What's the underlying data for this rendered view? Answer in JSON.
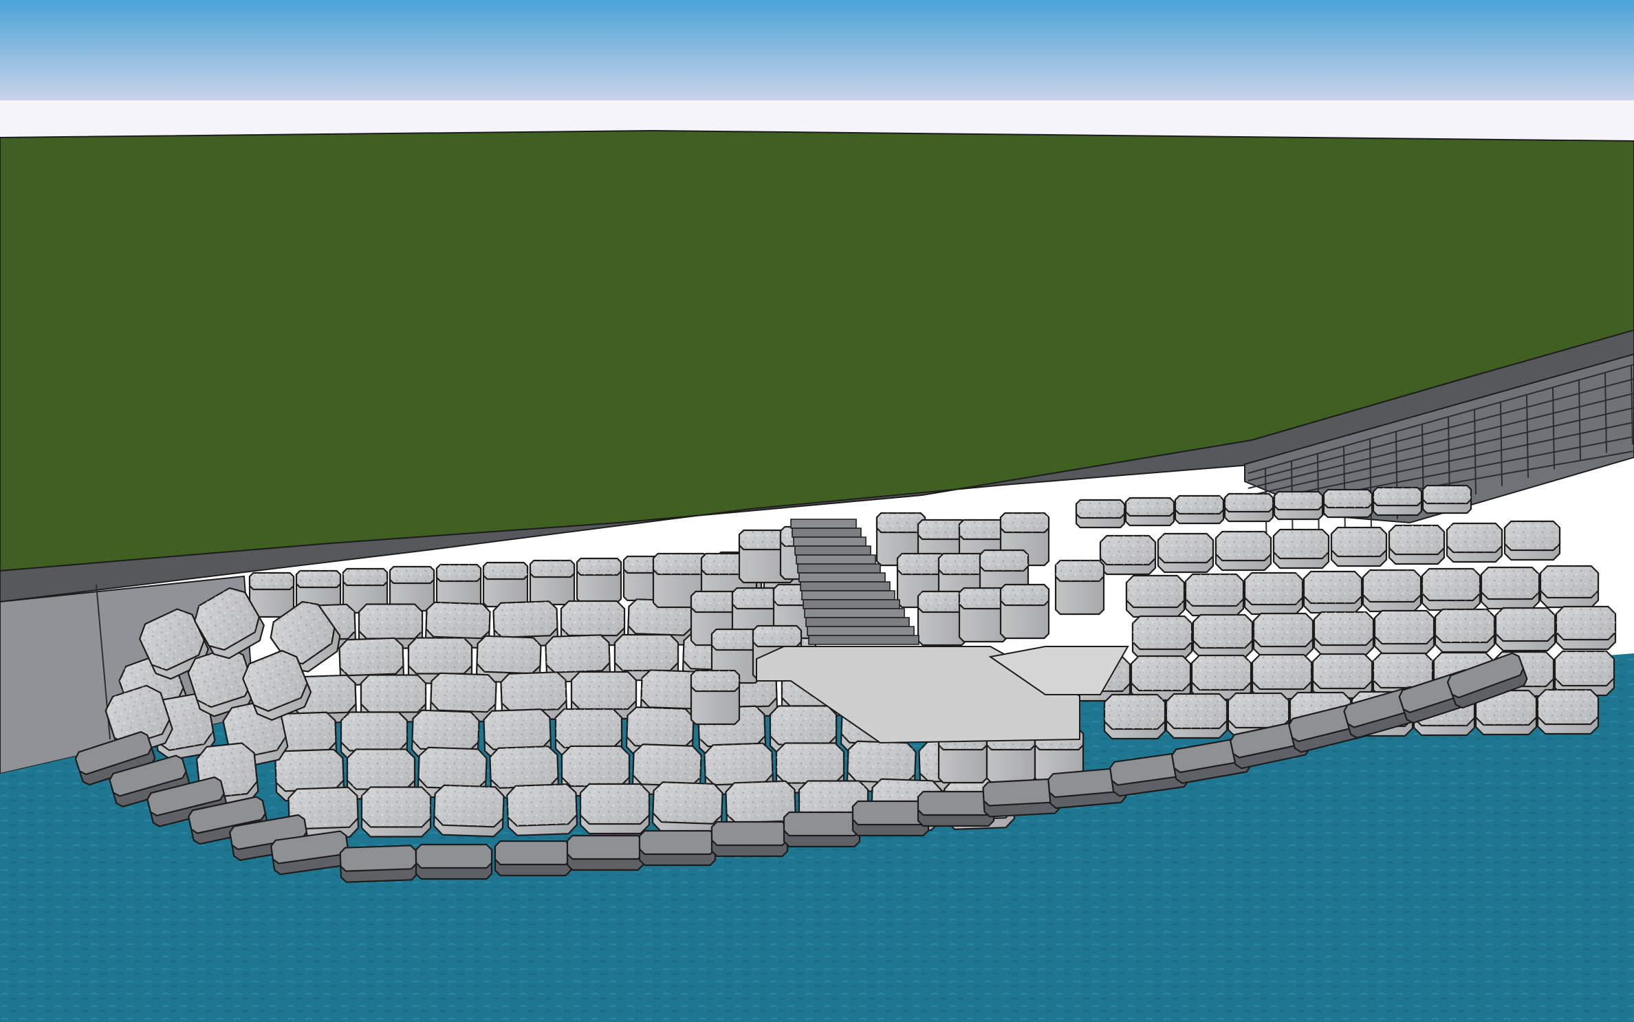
{
  "scene": {
    "colors": {
      "sky_top": "#4aa3d6",
      "sky_horizon": "#f6f4fb",
      "grass": "#3f6021",
      "path": "#56595c",
      "wall": "#8f9296",
      "water": "#1f7691",
      "stone": "#c9cacb",
      "dark_stone": "#7e8084",
      "platform": "#cfcfcf"
    },
    "icons": [
      "seawall",
      "steps",
      "armour-stone-revetment",
      "water"
    ]
  }
}
